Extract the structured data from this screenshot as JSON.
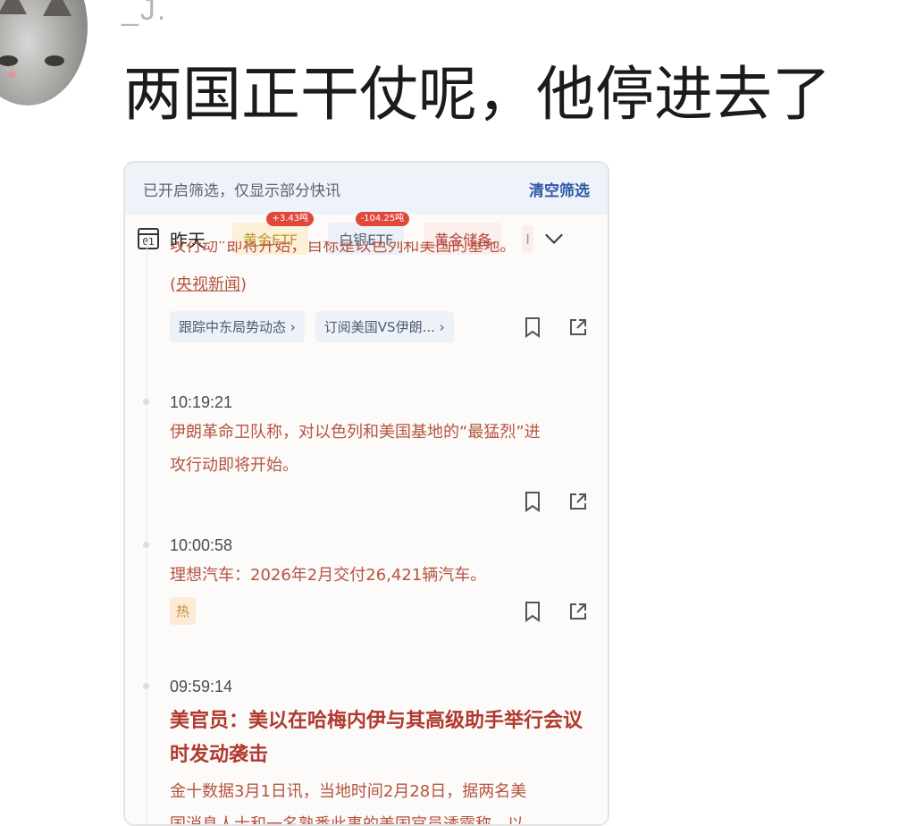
{
  "post": {
    "username": "_J.",
    "text": "两国正干仗呢，他停进去了"
  },
  "card": {
    "filter_notice": "已开启筛选，仅显示部分快讯",
    "clear_filter_label": "清空筛选",
    "calendar_day": "01",
    "date_label": "昨天",
    "chips": [
      {
        "label": "黄金ETF",
        "badge": "+3.43吨"
      },
      {
        "label": "白银ETF",
        "badge": "-104.25吨"
      },
      {
        "label": "黄金储备"
      },
      {
        "label": "I"
      }
    ],
    "truncated_text": "攻行动”即将开始，目标是以色列和美国的基地。",
    "source_label": "央视新闻",
    "tags": [
      "跟踪中东局势动态",
      "订阅美国VS伊朗..."
    ],
    "items": [
      {
        "time": "10:19:21",
        "text_line1": "伊朗革命卫队称，对以色列和美国基地的“最猛烈”进",
        "text_line2": "攻行动即将开始。"
      },
      {
        "time": "10:00:58",
        "text": "理想汽车：2026年2月交付26,421辆汽车。",
        "hot_label": "热"
      },
      {
        "time": "09:59:14",
        "headline_line1": "美官员：美以在哈梅内伊与其高级助手举行会议",
        "headline_line2": "时发动袭击",
        "text_line1": "金十数据3月1日讯，当地时间2月28日，据两名美",
        "text_line2": "国消息人士和一名熟悉此事的美国官员透露称，以"
      }
    ]
  }
}
